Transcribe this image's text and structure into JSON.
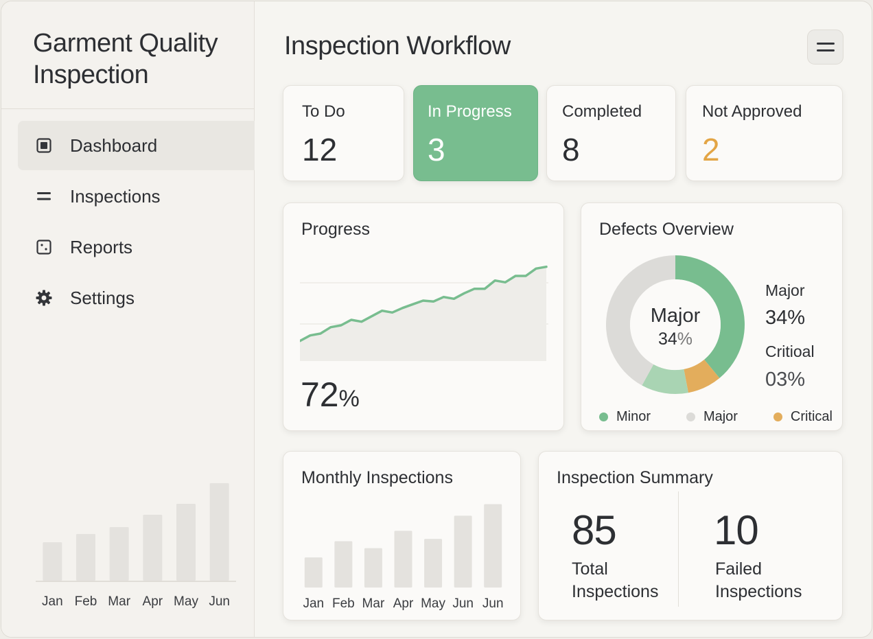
{
  "sidebar": {
    "brand_line1": "Garment Quality",
    "brand_line2": "Inspection",
    "items": [
      {
        "label": "Dashboard",
        "icon": "dashboard-icon",
        "active": true
      },
      {
        "label": "Inspections",
        "icon": "list-icon",
        "active": false
      },
      {
        "label": "Reports",
        "icon": "reports-icon",
        "active": false
      },
      {
        "label": "Settings",
        "icon": "gear-icon",
        "active": false
      }
    ],
    "chart": {
      "type": "bar",
      "categories": [
        "Jan",
        "Feb",
        "Mar",
        "Apr",
        "May",
        "Jun"
      ],
      "values": [
        28,
        34,
        39,
        48,
        56,
        71
      ],
      "ylim": [
        0,
        80
      ]
    }
  },
  "header": {
    "title": "Inspection Workflow",
    "menu_icon": "menu-icon"
  },
  "status_cards": [
    {
      "label": "To Do",
      "value": "12"
    },
    {
      "label": "In Progress",
      "value": "3"
    },
    {
      "label": "Completed",
      "value": "8"
    },
    {
      "label": "Not Approved",
      "value": "2"
    }
  ],
  "progress": {
    "title": "Progress",
    "value": "72",
    "unit": "%"
  },
  "defects": {
    "title": "Defects Overview",
    "center_label": "Major",
    "center_value": "34",
    "center_unit": "%",
    "major_label": "Major",
    "major_value": "34%",
    "critical_label": "Critioal",
    "critical_value": "03%",
    "legend": [
      {
        "label": "Minor",
        "color": "#78bd8f"
      },
      {
        "label": "Major",
        "color": "#dcdbd8"
      },
      {
        "label": "Critical",
        "color": "#e3ad5c"
      }
    ]
  },
  "monthly": {
    "title": "Monthly Inspections"
  },
  "summary": {
    "title": "Inspection Summary",
    "total_value": "85",
    "total_label_1": "Total",
    "total_label_2": "Inspections",
    "failed_value": "10",
    "failed_label_1": "Failed",
    "failed_label_2": "Inspections"
  },
  "colors": {
    "accent_green": "#78bd8f",
    "light_green": "#a9d4b3",
    "warning_orange": "#e3a545",
    "neutral_grey": "#dcdbd8"
  },
  "chart_data": [
    {
      "type": "line",
      "x": [
        0,
        1,
        2,
        3,
        4,
        5,
        6,
        7,
        8,
        9,
        10,
        11,
        12,
        13,
        14,
        15,
        16,
        17,
        18,
        19,
        20,
        21,
        22,
        23,
        24
      ],
      "values": [
        22,
        28,
        30,
        37,
        39,
        45,
        43,
        49,
        55,
        53,
        58,
        62,
        66,
        65,
        70,
        68,
        74,
        79,
        79,
        88,
        86,
        93,
        93,
        101,
        103
      ],
      "ylim": [
        0,
        120
      ],
      "area_fill": true,
      "grid": "horizontal"
    },
    {
      "type": "pie",
      "categories": [
        "Minor",
        "Critical",
        "Major light",
        "Major"
      ],
      "values": [
        39,
        8,
        11,
        42
      ],
      "colors": [
        "#78bd8f",
        "#e3ad5c",
        "#a9d4b3",
        "#dcdbd8"
      ],
      "donut": true
    },
    {
      "type": "bar",
      "categories": [
        "Jan",
        "Feb",
        "Mar",
        "Apr",
        "May",
        "Jun",
        "Jun"
      ],
      "values": [
        26,
        40,
        34,
        49,
        42,
        62,
        72
      ],
      "ylim": [
        0,
        80
      ]
    }
  ]
}
